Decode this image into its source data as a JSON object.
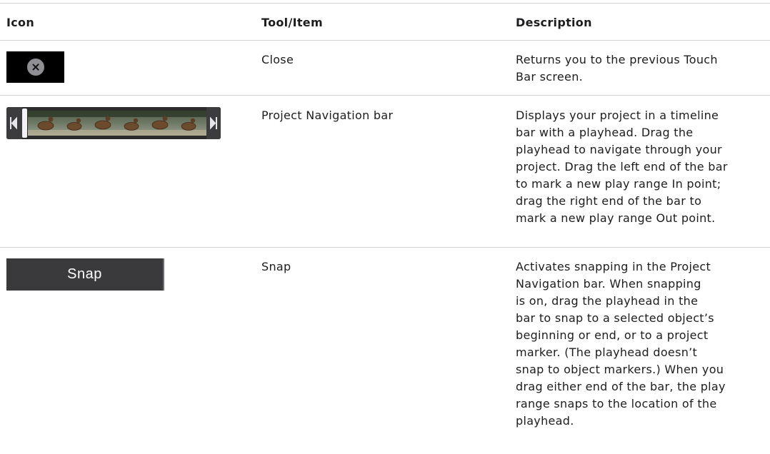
{
  "header": {
    "icon": "Icon",
    "tool": "Tool/Item",
    "description": "Description"
  },
  "rows": [
    {
      "icon": "close-icon",
      "tool": "Close",
      "description": [
        "Returns you to the previous Touch",
        "Bar screen."
      ]
    },
    {
      "icon": "project-navigation-bar-icon",
      "tool": "Project Navigation bar",
      "description": [
        "Displays your project in a timeline",
        "bar with a playhead. Drag the",
        "playhead to navigate through your",
        "project. Drag the left end of the bar",
        "to mark a new play range In point;",
        "drag the right end of the bar to",
        "mark a new play range Out point."
      ]
    },
    {
      "icon": "snap-button",
      "icon_label": "Snap",
      "tool": "Snap",
      "description": [
        "Activates snapping in the Project",
        "Navigation bar. When snapping",
        "is on, drag the playhead in the",
        "bar to snap to a selected object’s",
        "beginning or end, or to a project",
        "marker. (The playhead doesn’t",
        "snap to object markers.) When you",
        "drag either end of the bar, the play",
        "range snaps to the location of the",
        "playhead."
      ]
    }
  ],
  "colors": {
    "rule": "#d2d2d7",
    "text": "#1d1d1f",
    "touch_bar_bg": "#000000",
    "snap_bg": "#3a3a3c"
  }
}
